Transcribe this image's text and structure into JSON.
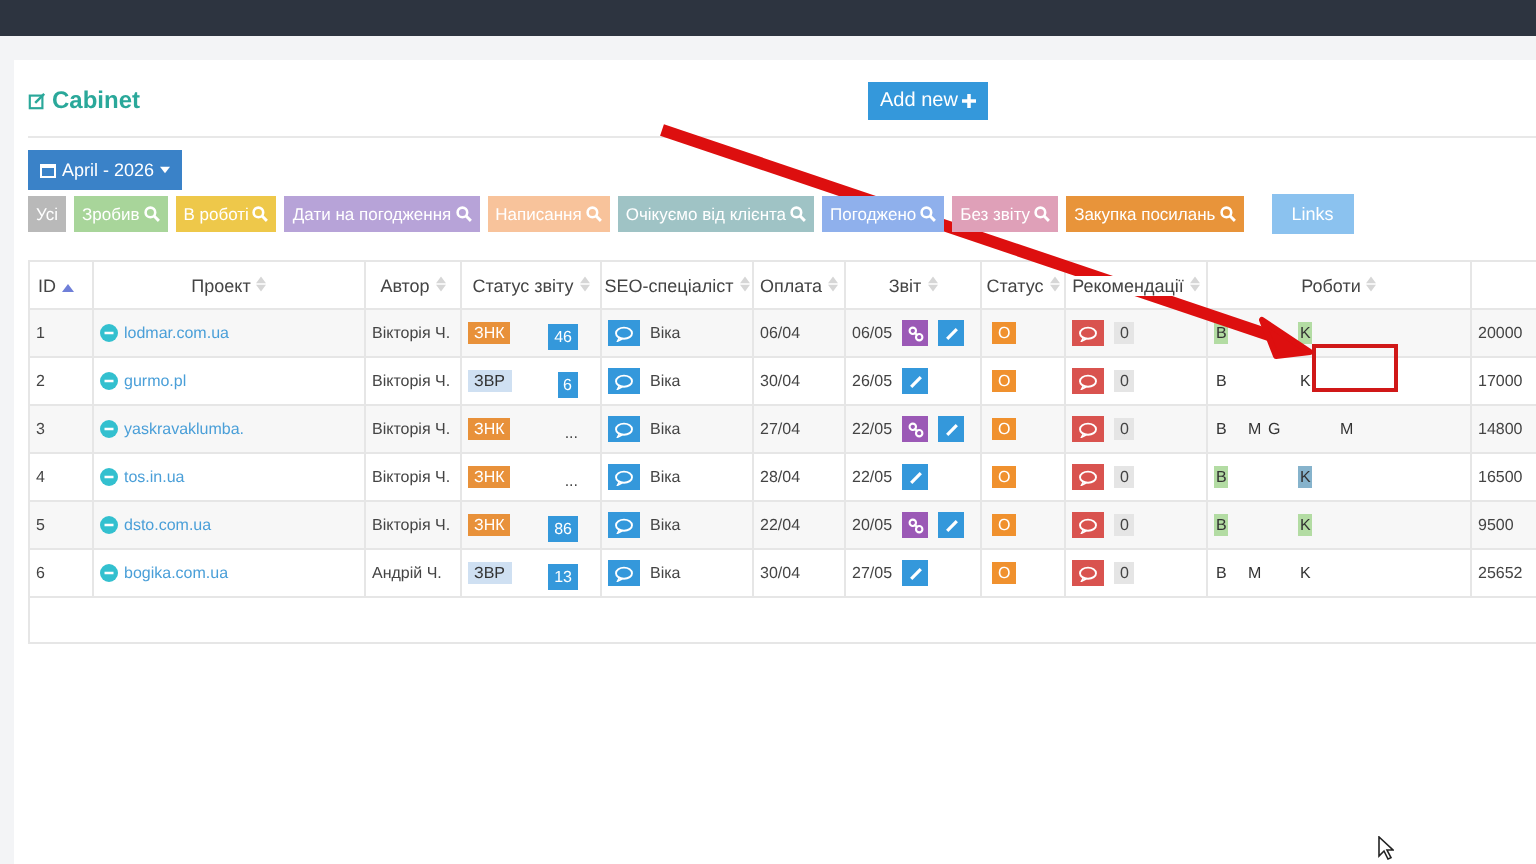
{
  "title": "Cabinet",
  "add_button": "Add new",
  "month_button": "April - 2026",
  "filters": [
    {
      "label": "Усі",
      "color": "#b9b9b9",
      "search": false
    },
    {
      "label": "Зробив",
      "color": "#a8d59a",
      "search": true
    },
    {
      "label": "В роботі",
      "color": "#eec84a",
      "search": true
    },
    {
      "label": "Дати на погодження",
      "color": "#b7a3d8",
      "search": true
    },
    {
      "label": "Написання",
      "color": "#f8c39b",
      "search": true
    },
    {
      "label": "Очікуємо від клієнта",
      "color": "#9fc3c5",
      "search": true
    },
    {
      "label": "Погоджено",
      "color": "#8fb0ec",
      "search": true
    },
    {
      "label": "Без звіту",
      "color": "#dfa0b8",
      "search": true
    },
    {
      "label": "Закупка посилань",
      "color": "#e8943a",
      "search": true
    }
  ],
  "links_button": "Links",
  "table": {
    "columns": [
      {
        "label": "ID",
        "sort_ascending": true
      },
      {
        "label": "Проект",
        "sort_ascending": false
      },
      {
        "label": "Автор",
        "sort_ascending": false
      },
      {
        "label": "Статус звіту",
        "sort_ascending": false
      },
      {
        "label": "SEO-спеціаліст",
        "sort_ascending": false
      },
      {
        "label": "Оплата",
        "sort_ascending": false
      },
      {
        "label": "Звіт",
        "sort_ascending": false
      },
      {
        "label": "Статус",
        "sort_ascending": false
      },
      {
        "label": "Рекомендації",
        "sort_ascending": false
      },
      {
        "label": "Роботи",
        "sort_ascending": false
      }
    ],
    "rows": [
      {
        "id": "1",
        "project": "lodmar.com.ua",
        "author": "Вікторія Ч.",
        "report_status": {
          "label": "ЗНК",
          "kind": "znk"
        },
        "count": {
          "text": "46",
          "kind": "badge"
        },
        "seo": "Віка",
        "payment": "06/04",
        "report_date": "06/05",
        "report_link": true,
        "status": "O",
        "recommendations": "0",
        "robots": [
          {
            "label": "B",
            "kind": "b",
            "color": "#b3dca3"
          },
          {
            "label": "K",
            "kind": "k",
            "color": "#b3dca3"
          }
        ],
        "sum": "20000"
      },
      {
        "id": "2",
        "project": "gurmo.pl",
        "author": "Вікторія Ч.",
        "report_status": {
          "label": "ЗВР",
          "kind": "zvr"
        },
        "count": {
          "text": "6",
          "kind": "badge"
        },
        "seo": "Віка",
        "payment": "30/04",
        "report_date": "26/05",
        "report_link": false,
        "status": "O",
        "recommendations": "0",
        "robots": [
          {
            "label": "B",
            "kind": "b"
          },
          {
            "label": "K",
            "kind": "k"
          }
        ],
        "sum": "17000"
      },
      {
        "id": "3",
        "project": "yaskravaklumba.",
        "author": "Вікторія Ч.",
        "report_status": {
          "label": "ЗНК",
          "kind": "znk"
        },
        "count": {
          "text": "...",
          "kind": "plain"
        },
        "seo": "Віка",
        "payment": "27/04",
        "report_date": "22/05",
        "report_link": true,
        "status": "O",
        "recommendations": "0",
        "robots": [
          {
            "label": "B",
            "kind": "b"
          },
          {
            "label": "M",
            "kind": "m"
          },
          {
            "label": "G",
            "kind": "g"
          },
          {
            "label": "M",
            "kind": "n"
          }
        ],
        "sum": "14800"
      },
      {
        "id": "4",
        "project": "tos.in.ua",
        "author": "Вікторія Ч.",
        "report_status": {
          "label": "ЗНК",
          "kind": "znk"
        },
        "count": {
          "text": "...",
          "kind": "plain"
        },
        "seo": "Віка",
        "payment": "28/04",
        "report_date": "22/05",
        "report_link": false,
        "status": "O",
        "recommendations": "0",
        "robots": [
          {
            "label": "B",
            "kind": "b",
            "color": "#b3dca3"
          },
          {
            "label": "K",
            "kind": "k",
            "color": "#86b3cc"
          }
        ],
        "sum": "16500"
      },
      {
        "id": "5",
        "project": "dsto.com.ua",
        "author": "Вікторія Ч.",
        "report_status": {
          "label": "ЗНК",
          "kind": "znk"
        },
        "count": {
          "text": "86",
          "kind": "badge"
        },
        "seo": "Віка",
        "payment": "22/04",
        "report_date": "20/05",
        "report_link": true,
        "status": "O",
        "recommendations": "0",
        "robots": [
          {
            "label": "B",
            "kind": "b",
            "color": "#b3dca3"
          },
          {
            "label": "K",
            "kind": "k",
            "color": "#b3dca3"
          }
        ],
        "sum": "9500"
      },
      {
        "id": "6",
        "project": "bogika.com.ua",
        "author": "Андрій Ч.",
        "report_status": {
          "label": "ЗВР",
          "kind": "zvr"
        },
        "count": {
          "text": "13",
          "kind": "badge"
        },
        "seo": "Віка",
        "payment": "30/04",
        "report_date": "27/05",
        "report_link": false,
        "status": "O",
        "recommendations": "0",
        "robots": [
          {
            "label": "B",
            "kind": "b"
          },
          {
            "label": "M",
            "kind": "m"
          },
          {
            "label": "K",
            "kind": "k"
          }
        ],
        "sum": "25652"
      }
    ]
  }
}
